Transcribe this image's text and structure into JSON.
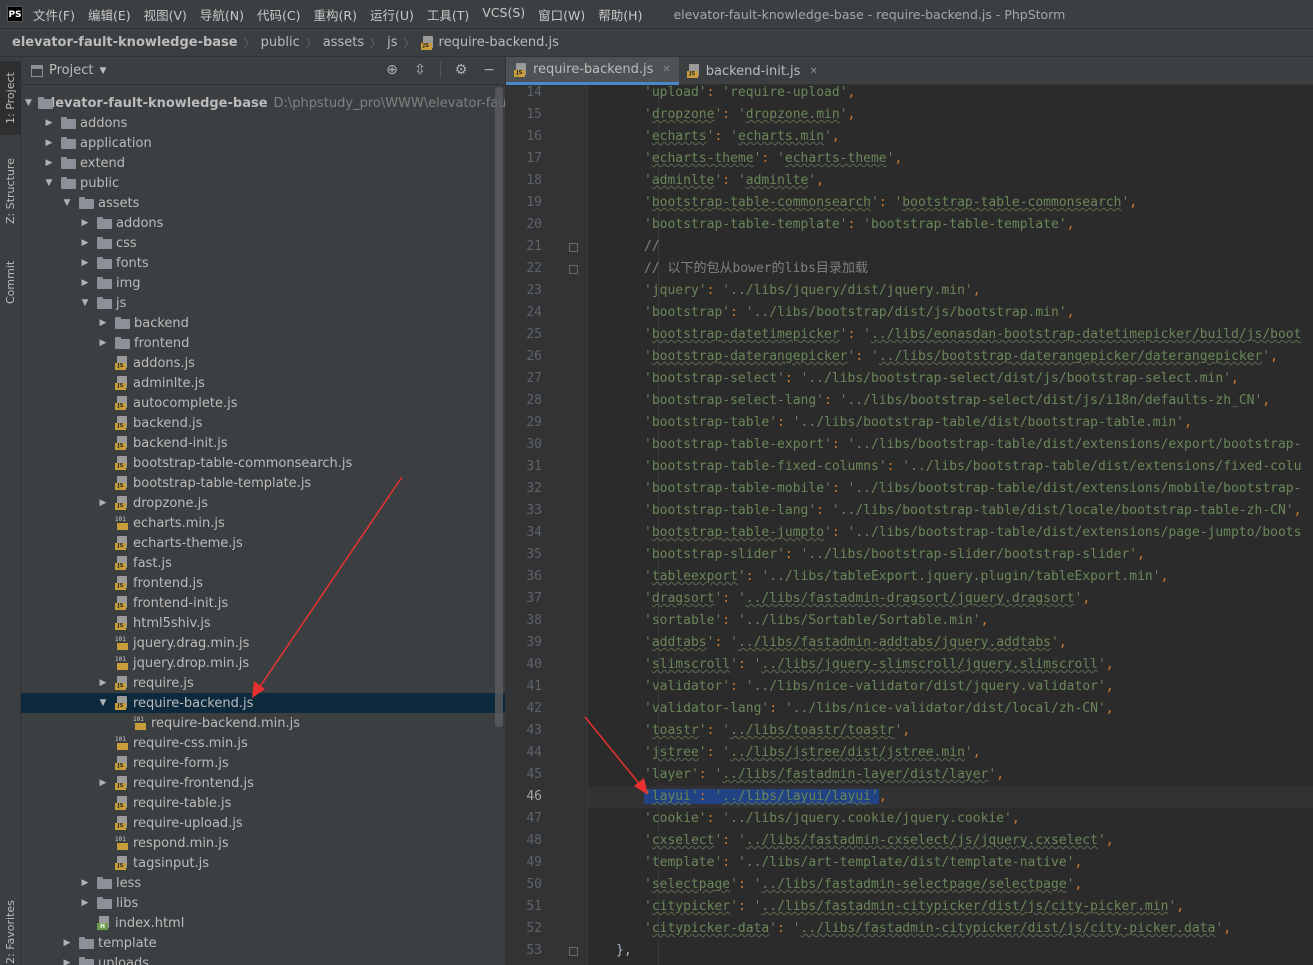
{
  "menubar": {
    "items": [
      "文件(F)",
      "编辑(E)",
      "视图(V)",
      "导航(N)",
      "代码(C)",
      "重构(R)",
      "运行(U)",
      "工具(T)",
      "VCS(S)",
      "窗口(W)",
      "帮助(H)"
    ],
    "window_title": "elevator-fault-knowledge-base - require-backend.js - PhpStorm"
  },
  "breadcrumb": [
    "elevator-fault-knowledge-base",
    "public",
    "assets",
    "js",
    "require-backend.js"
  ],
  "tool_strip": {
    "project": "1: Project",
    "structure": "Z: Structure",
    "commit": "Commit",
    "favorites": "2: Favorites"
  },
  "project_panel": {
    "title": "Project",
    "root_path": "D:\\phpstudy_pro\\WWW\\elevator-fault-kno",
    "tree": [
      {
        "label": "elevator-fault-knowledge-base",
        "depth": 0,
        "kind": "root",
        "arrow": "open"
      },
      {
        "label": "addons",
        "depth": 1,
        "kind": "folder",
        "arrow": "closed"
      },
      {
        "label": "application",
        "depth": 1,
        "kind": "folder",
        "arrow": "closed"
      },
      {
        "label": "extend",
        "depth": 1,
        "kind": "folder",
        "arrow": "closed"
      },
      {
        "label": "public",
        "depth": 1,
        "kind": "folder",
        "arrow": "open"
      },
      {
        "label": "assets",
        "depth": 2,
        "kind": "folder",
        "arrow": "open"
      },
      {
        "label": "addons",
        "depth": 3,
        "kind": "folder",
        "arrow": "closed"
      },
      {
        "label": "css",
        "depth": 3,
        "kind": "folder",
        "arrow": "closed"
      },
      {
        "label": "fonts",
        "depth": 3,
        "kind": "folder",
        "arrow": "closed"
      },
      {
        "label": "img",
        "depth": 3,
        "kind": "folder",
        "arrow": "closed"
      },
      {
        "label": "js",
        "depth": 3,
        "kind": "folder",
        "arrow": "open"
      },
      {
        "label": "backend",
        "depth": 4,
        "kind": "folder",
        "arrow": "closed"
      },
      {
        "label": "frontend",
        "depth": 4,
        "kind": "folder",
        "arrow": "closed"
      },
      {
        "label": "addons.js",
        "depth": 4,
        "kind": "js",
        "arrow": "none"
      },
      {
        "label": "adminlte.js",
        "depth": 4,
        "kind": "js",
        "arrow": "none"
      },
      {
        "label": "autocomplete.js",
        "depth": 4,
        "kind": "js",
        "arrow": "none"
      },
      {
        "label": "backend.js",
        "depth": 4,
        "kind": "js",
        "arrow": "none"
      },
      {
        "label": "backend-init.js",
        "depth": 4,
        "kind": "js",
        "arrow": "none"
      },
      {
        "label": "bootstrap-table-commonsearch.js",
        "depth": 4,
        "kind": "js",
        "arrow": "none"
      },
      {
        "label": "bootstrap-table-template.js",
        "depth": 4,
        "kind": "js",
        "arrow": "none"
      },
      {
        "label": "dropzone.js",
        "depth": 4,
        "kind": "js",
        "arrow": "closed"
      },
      {
        "label": "echarts.min.js",
        "depth": 4,
        "kind": "bin",
        "arrow": "none"
      },
      {
        "label": "echarts-theme.js",
        "depth": 4,
        "kind": "js",
        "arrow": "none"
      },
      {
        "label": "fast.js",
        "depth": 4,
        "kind": "js",
        "arrow": "none"
      },
      {
        "label": "frontend.js",
        "depth": 4,
        "kind": "js",
        "arrow": "none"
      },
      {
        "label": "frontend-init.js",
        "depth": 4,
        "kind": "js",
        "arrow": "none"
      },
      {
        "label": "html5shiv.js",
        "depth": 4,
        "kind": "js",
        "arrow": "none"
      },
      {
        "label": "jquery.drag.min.js",
        "depth": 4,
        "kind": "bin",
        "arrow": "none"
      },
      {
        "label": "jquery.drop.min.js",
        "depth": 4,
        "kind": "bin",
        "arrow": "none"
      },
      {
        "label": "require.js",
        "depth": 4,
        "kind": "js",
        "arrow": "closed"
      },
      {
        "label": "require-backend.js",
        "depth": 4,
        "kind": "js",
        "arrow": "open",
        "selected": true
      },
      {
        "label": "require-backend.min.js",
        "depth": 5,
        "kind": "bin",
        "arrow": "none"
      },
      {
        "label": "require-css.min.js",
        "depth": 4,
        "kind": "bin",
        "arrow": "none"
      },
      {
        "label": "require-form.js",
        "depth": 4,
        "kind": "js",
        "arrow": "none"
      },
      {
        "label": "require-frontend.js",
        "depth": 4,
        "kind": "js",
        "arrow": "closed"
      },
      {
        "label": "require-table.js",
        "depth": 4,
        "kind": "js",
        "arrow": "none"
      },
      {
        "label": "require-upload.js",
        "depth": 4,
        "kind": "js",
        "arrow": "none"
      },
      {
        "label": "respond.min.js",
        "depth": 4,
        "kind": "bin",
        "arrow": "none"
      },
      {
        "label": "tagsinput.js",
        "depth": 4,
        "kind": "js",
        "arrow": "none"
      },
      {
        "label": "less",
        "depth": 3,
        "kind": "folder",
        "arrow": "closed"
      },
      {
        "label": "libs",
        "depth": 3,
        "kind": "folder",
        "arrow": "closed"
      },
      {
        "label": "index.html",
        "depth": 3,
        "kind": "html",
        "arrow": "none"
      },
      {
        "label": "template",
        "depth": 2,
        "kind": "folder",
        "arrow": "closed"
      },
      {
        "label": "uploads",
        "depth": 2,
        "kind": "folder",
        "arrow": "closed"
      }
    ]
  },
  "editor": {
    "tabs": [
      {
        "label": "require-backend.js",
        "active": true
      },
      {
        "label": "backend-init.js",
        "active": false
      }
    ],
    "current_line": 46,
    "lines": [
      {
        "n": 14,
        "key": "upload",
        "val": "require-upload",
        "wavy": []
      },
      {
        "n": 15,
        "key": "dropzone",
        "val": "dropzone.min",
        "wavy": [
          "k",
          "v"
        ]
      },
      {
        "n": 16,
        "key": "echarts",
        "val": "echarts.min",
        "wavy": [
          "k",
          "v"
        ]
      },
      {
        "n": 17,
        "key": "echarts-theme",
        "val": "echarts-theme",
        "wavy": [
          "k",
          "v"
        ]
      },
      {
        "n": 18,
        "key": "adminlte",
        "val": "adminlte",
        "wavy": [
          "k",
          "v"
        ]
      },
      {
        "n": 19,
        "key": "bootstrap-table-commonsearch",
        "val": "bootstrap-table-commonsearch",
        "wavy": [
          "k",
          "v"
        ]
      },
      {
        "n": 20,
        "key": "bootstrap-table-template",
        "val": "bootstrap-table-template",
        "wavy": []
      },
      {
        "n": 21,
        "comment": "//"
      },
      {
        "n": 22,
        "comment": "// 以下的包从bower的libs目录加载"
      },
      {
        "n": 23,
        "key": "jquery",
        "val": "../libs/jquery/dist/jquery.min",
        "wavy": []
      },
      {
        "n": 24,
        "key": "bootstrap",
        "val": "../libs/bootstrap/dist/js/bootstrap.min",
        "wavy": []
      },
      {
        "n": 25,
        "key": "bootstrap-datetimepicker",
        "val": "../libs/eonasdan-bootstrap-datetimepicker/build/js/boot",
        "wavy": [
          "k",
          "v"
        ],
        "open": true
      },
      {
        "n": 26,
        "key": "bootstrap-daterangepicker",
        "val": "../libs/bootstrap-daterangepicker/daterangepicker",
        "wavy": [
          "k",
          "v"
        ]
      },
      {
        "n": 27,
        "key": "bootstrap-select",
        "val": "../libs/bootstrap-select/dist/js/bootstrap-select.min",
        "wavy": []
      },
      {
        "n": 28,
        "key": "bootstrap-select-lang",
        "val": "../libs/bootstrap-select/dist/js/i18n/defaults-zh_CN",
        "wavy": []
      },
      {
        "n": 29,
        "key": "bootstrap-table",
        "val": "../libs/bootstrap-table/dist/bootstrap-table.min",
        "wavy": []
      },
      {
        "n": 30,
        "key": "bootstrap-table-export",
        "val": "../libs/bootstrap-table/dist/extensions/export/bootstrap-",
        "wavy": [],
        "open": true
      },
      {
        "n": 31,
        "key": "bootstrap-table-fixed-columns",
        "val": "../libs/bootstrap-table/dist/extensions/fixed-colu",
        "wavy": [],
        "open": true
      },
      {
        "n": 32,
        "key": "bootstrap-table-mobile",
        "val": "../libs/bootstrap-table/dist/extensions/mobile/bootstrap-",
        "wavy": [],
        "open": true
      },
      {
        "n": 33,
        "key": "bootstrap-table-lang",
        "val": "../libs/bootstrap-table/dist/locale/bootstrap-table-zh-CN",
        "wavy": []
      },
      {
        "n": 34,
        "key": "bootstrap-table-jumpto",
        "val": "../libs/bootstrap-table/dist/extensions/page-jumpto/boots",
        "wavy": [
          "k"
        ],
        "open": true
      },
      {
        "n": 35,
        "key": "bootstrap-slider",
        "val": "../libs/bootstrap-slider/bootstrap-slider",
        "wavy": []
      },
      {
        "n": 36,
        "key": "tableexport",
        "val": "../libs/tableExport.jquery.plugin/tableExport.min",
        "wavy": [
          "k"
        ]
      },
      {
        "n": 37,
        "key": "dragsort",
        "val": "../libs/fastadmin-dragsort/jquery.dragsort",
        "wavy": [
          "k",
          "v"
        ]
      },
      {
        "n": 38,
        "key": "sortable",
        "val": "../libs/Sortable/Sortable.min",
        "wavy": []
      },
      {
        "n": 39,
        "key": "addtabs",
        "val": "../libs/fastadmin-addtabs/jquery.addtabs",
        "wavy": [
          "k",
          "v"
        ]
      },
      {
        "n": 40,
        "key": "slimscroll",
        "val": "../libs/jquery-slimscroll/jquery.slimscroll",
        "wavy": [
          "k",
          "v"
        ]
      },
      {
        "n": 41,
        "key": "validator",
        "val": "../libs/nice-validator/dist/jquery.validator",
        "wavy": []
      },
      {
        "n": 42,
        "key": "validator-lang",
        "val": "../libs/nice-validator/dist/local/zh-CN",
        "wavy": []
      },
      {
        "n": 43,
        "key": "toastr",
        "val": "../libs/toastr/toastr",
        "wavy": [
          "k",
          "v"
        ]
      },
      {
        "n": 44,
        "key": "jstree",
        "val": "../libs/jstree/dist/jstree.min",
        "wavy": [
          "k",
          "v"
        ]
      },
      {
        "n": 45,
        "key": "layer",
        "val": "../libs/fastadmin-layer/dist/layer",
        "wavy": [
          "v"
        ]
      },
      {
        "n": 46,
        "key": "layui",
        "val": "../libs/layui/layui",
        "wavy": [
          "k",
          "v"
        ],
        "selected": true
      },
      {
        "n": 47,
        "key": "cookie",
        "val": "../libs/jquery.cookie/jquery.cookie",
        "wavy": []
      },
      {
        "n": 48,
        "key": "cxselect",
        "val": "../libs/fastadmin-cxselect/js/jquery.cxselect",
        "wavy": [
          "k",
          "v"
        ]
      },
      {
        "n": 49,
        "key": "template",
        "val": "../libs/art-template/dist/template-native",
        "wavy": []
      },
      {
        "n": 50,
        "key": "selectpage",
        "val": "../libs/fastadmin-selectpage/selectpage",
        "wavy": [
          "k",
          "v"
        ]
      },
      {
        "n": 51,
        "key": "citypicker",
        "val": "../libs/fastadmin-citypicker/dist/js/city-picker.min",
        "wavy": [
          "k",
          "v"
        ]
      },
      {
        "n": 52,
        "key": "citypicker-data",
        "val": "../libs/fastadmin-citypicker/dist/js/city-picker.data",
        "wavy": [
          "k",
          "v"
        ]
      },
      {
        "n": 53,
        "closing": "},"
      }
    ]
  }
}
